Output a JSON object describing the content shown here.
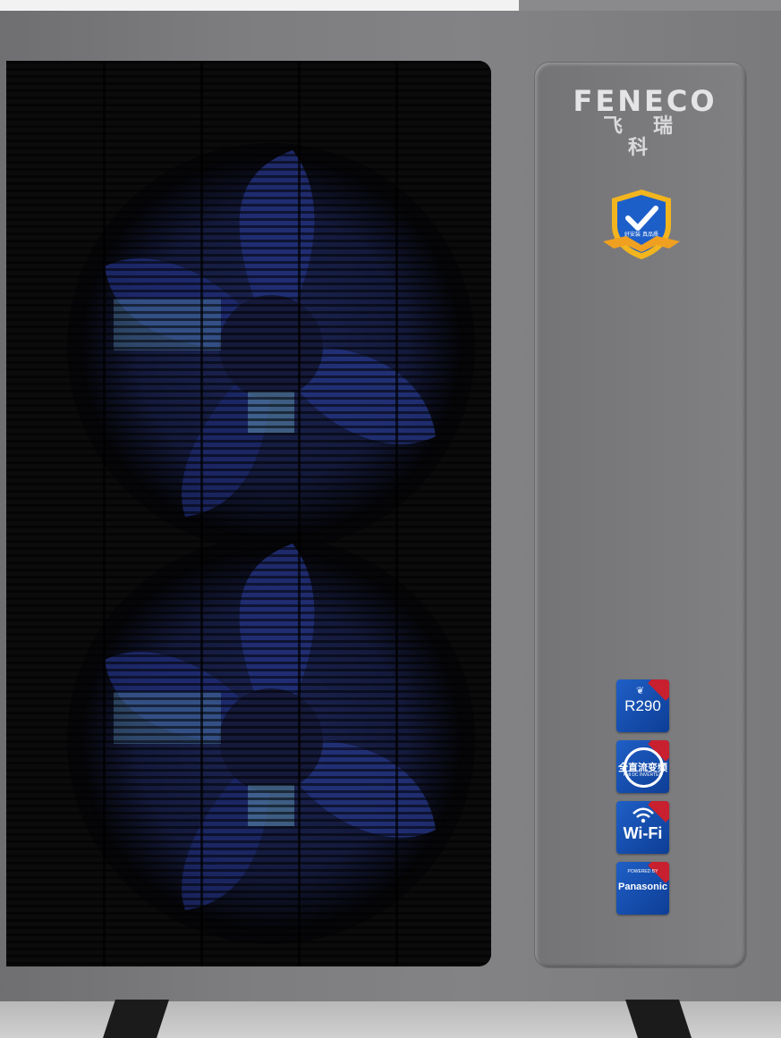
{
  "brand": {
    "logo_en": "FENECO",
    "logo_cn": "飞瑞科"
  },
  "certification": {
    "icon": "shield-check-icon",
    "text": "好安装 真品质"
  },
  "feature_badges": [
    {
      "id": "r290",
      "label": "R290",
      "icon": "leaf-icon",
      "color": "#1a55b8"
    },
    {
      "id": "dc-inverter",
      "label": "全直流变频",
      "sublabel": "Full DC INVERTER",
      "icon": "swirl-icon",
      "color": "#1a55b8"
    },
    {
      "id": "wifi",
      "label": "Wi-Fi",
      "icon": "wifi-icon",
      "color": "#1a55b8"
    },
    {
      "id": "panasonic",
      "prelabel": "POWERED BY",
      "label": "Panasonic",
      "icon": "brand-icon",
      "color": "#1a55b8"
    }
  ],
  "colors": {
    "casing": "#7c7c7e",
    "grille": "#0b0b0c",
    "fan_blades": "#1e2a6e",
    "badge_blue": "#1a55b8",
    "shield_gold": "#f2b51e"
  }
}
